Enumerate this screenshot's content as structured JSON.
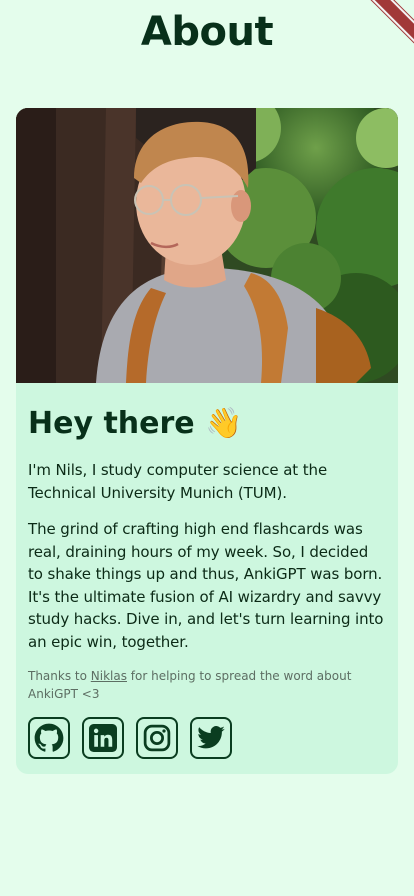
{
  "page": {
    "title": "About"
  },
  "card": {
    "photo_alt": "Portrait photo of Nils",
    "greeting": "Hey there",
    "greeting_emoji": "👋",
    "paragraph_1": "I'm Nils, I study computer science at the Technical University Munich (TUM).",
    "paragraph_2": "The grind of crafting high end flashcards was real, draining hours of my week. So, I decided to shake things up and thus, AnkiGPT was born. It's the ultimate fusion of AI wizardry and savvy study hacks. Dive in, and let's turn learning into an epic win, together.",
    "thanks_prefix": "Thanks to ",
    "thanks_link": "Niklas",
    "thanks_suffix": " for helping to spread the word about AnkiGPT <3",
    "socials": [
      {
        "icon": "github-icon",
        "label": "GitHub"
      },
      {
        "icon": "linkedin-icon",
        "label": "LinkedIn"
      },
      {
        "icon": "instagram-icon",
        "label": "Instagram"
      },
      {
        "icon": "twitter-icon",
        "label": "Twitter"
      }
    ]
  },
  "colors": {
    "background": "#e4fdec",
    "card": "#cdf7df",
    "text": "#0b2a16",
    "icon_stroke": "#0a3d20",
    "ribbon": "#a13838"
  }
}
